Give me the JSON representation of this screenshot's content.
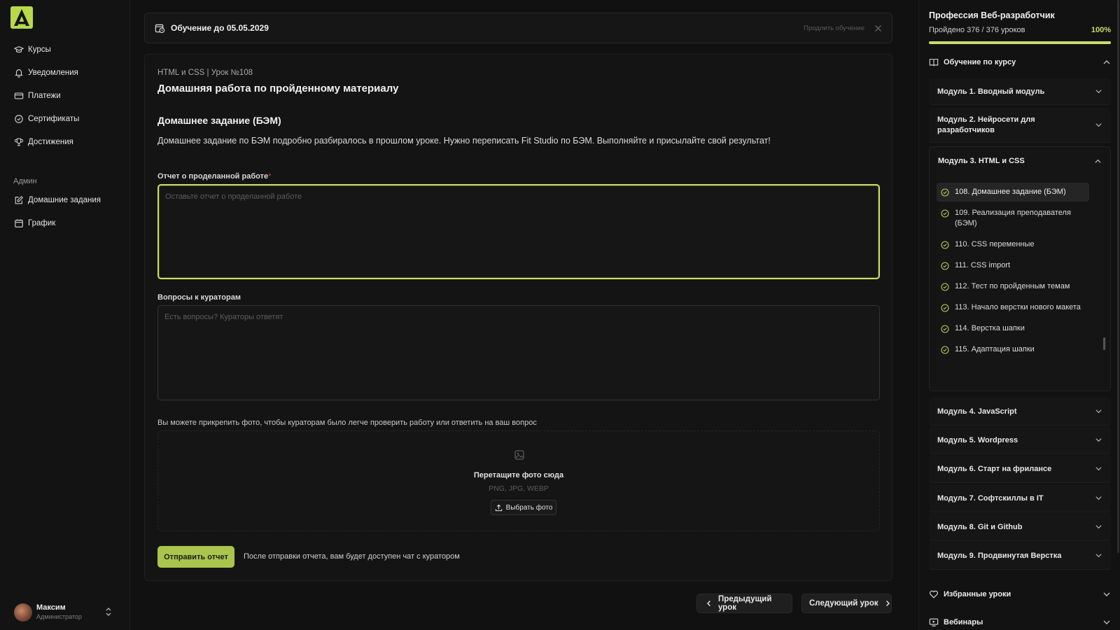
{
  "sidebar": {
    "nav": [
      {
        "label": "Курсы",
        "icon": "graduation-cap-icon"
      },
      {
        "label": "Уведомления",
        "icon": "bell-icon"
      },
      {
        "label": "Платежи",
        "icon": "credit-card-icon"
      },
      {
        "label": "Сертификаты",
        "icon": "badge-check-icon"
      },
      {
        "label": "Достижения",
        "icon": "trophy-icon"
      }
    ],
    "admin_title": "Админ",
    "admin_nav": [
      {
        "label": "Домашние задания",
        "icon": "edit-icon"
      },
      {
        "label": "График",
        "icon": "calendar-icon"
      }
    ],
    "user": {
      "name": "Максим",
      "role": "Администратор"
    }
  },
  "banner": {
    "title": "Обучение до 05.05.2029",
    "extend_label": "Продлить обучение"
  },
  "lesson": {
    "breadcrumb": "HTML и CSS | Урок №108",
    "title": "Домашняя работа по пройденному материалу",
    "hw_title": "Домашнее задание (БЭМ)",
    "hw_description": "Домашнее задание по БЭМ подробно разбиралось в прошлом уроке. Нужно переписать Fit Studio по БЭМ. Выполняйте и присылайте свой результат!",
    "report_label": "Отчет о проделанной работе",
    "report_required_mark": "*",
    "report_placeholder": "Оставьте отчет о проделанной работе",
    "questions_label": "Вопросы к кураторам",
    "questions_placeholder": "Есть вопросы? Кураторы ответят",
    "attach_hint": "Вы можете прикрепить фото, чтобы кураторам было легче проверить работу или ответить на ваш вопрос",
    "dropzone_title": "Перетащите фото сюда",
    "dropzone_formats": "PNG, JPG, WEBP",
    "dropzone_button": "Выбрать фото",
    "submit_label": "Отправить отчет",
    "submit_note": "После отправки отчета, вам будет доступен чат с куратором"
  },
  "pager": {
    "prev_label": "Предыдущий урок",
    "next_label": "Следующий урок"
  },
  "course_panel": {
    "profession_title": "Профессия Веб-разработчик",
    "progress_text": "Пройдено 376 / 376 уроков",
    "progress_percent": "100%",
    "progress_value": 1.0,
    "section_title": "Обучение по курсу",
    "modules_before": [
      {
        "label": "Модуль 1. Вводный модуль"
      },
      {
        "label": "Модуль 2. Нейросети для разработчиков"
      }
    ],
    "open_module": {
      "label": "Модуль 3. HTML и CSS",
      "lessons": [
        {
          "label": "108. Домашнее задание (БЭМ)",
          "current": true
        },
        {
          "label": "109. Реализация преподавателя (БЭМ)"
        },
        {
          "label": "110. CSS переменные"
        },
        {
          "label": "111. CSS import"
        },
        {
          "label": "112. Тест по пройденным темам"
        },
        {
          "label": "113. Начало верстки нового макета"
        },
        {
          "label": "114. Верстка шапки"
        },
        {
          "label": "115. Адаптация шапки"
        }
      ]
    },
    "modules_after": [
      {
        "label": "Модуль 4. JavaScript"
      },
      {
        "label": "Модуль 5. Wordpress"
      },
      {
        "label": "Модуль 6. Старт на фрилансе"
      },
      {
        "label": "Модуль 7. Софтскиллы в IT"
      },
      {
        "label": "Модуль 8. Git и Github"
      },
      {
        "label": "Модуль 9. Продвинутая Верстка"
      }
    ],
    "favorites_label": "Избранные уроки",
    "webinars_label": "Вебинары"
  },
  "colors": {
    "accent": "#c7df6a",
    "accent_button": "#a9c54d",
    "background": "#111111",
    "required": "#d23b3b"
  }
}
